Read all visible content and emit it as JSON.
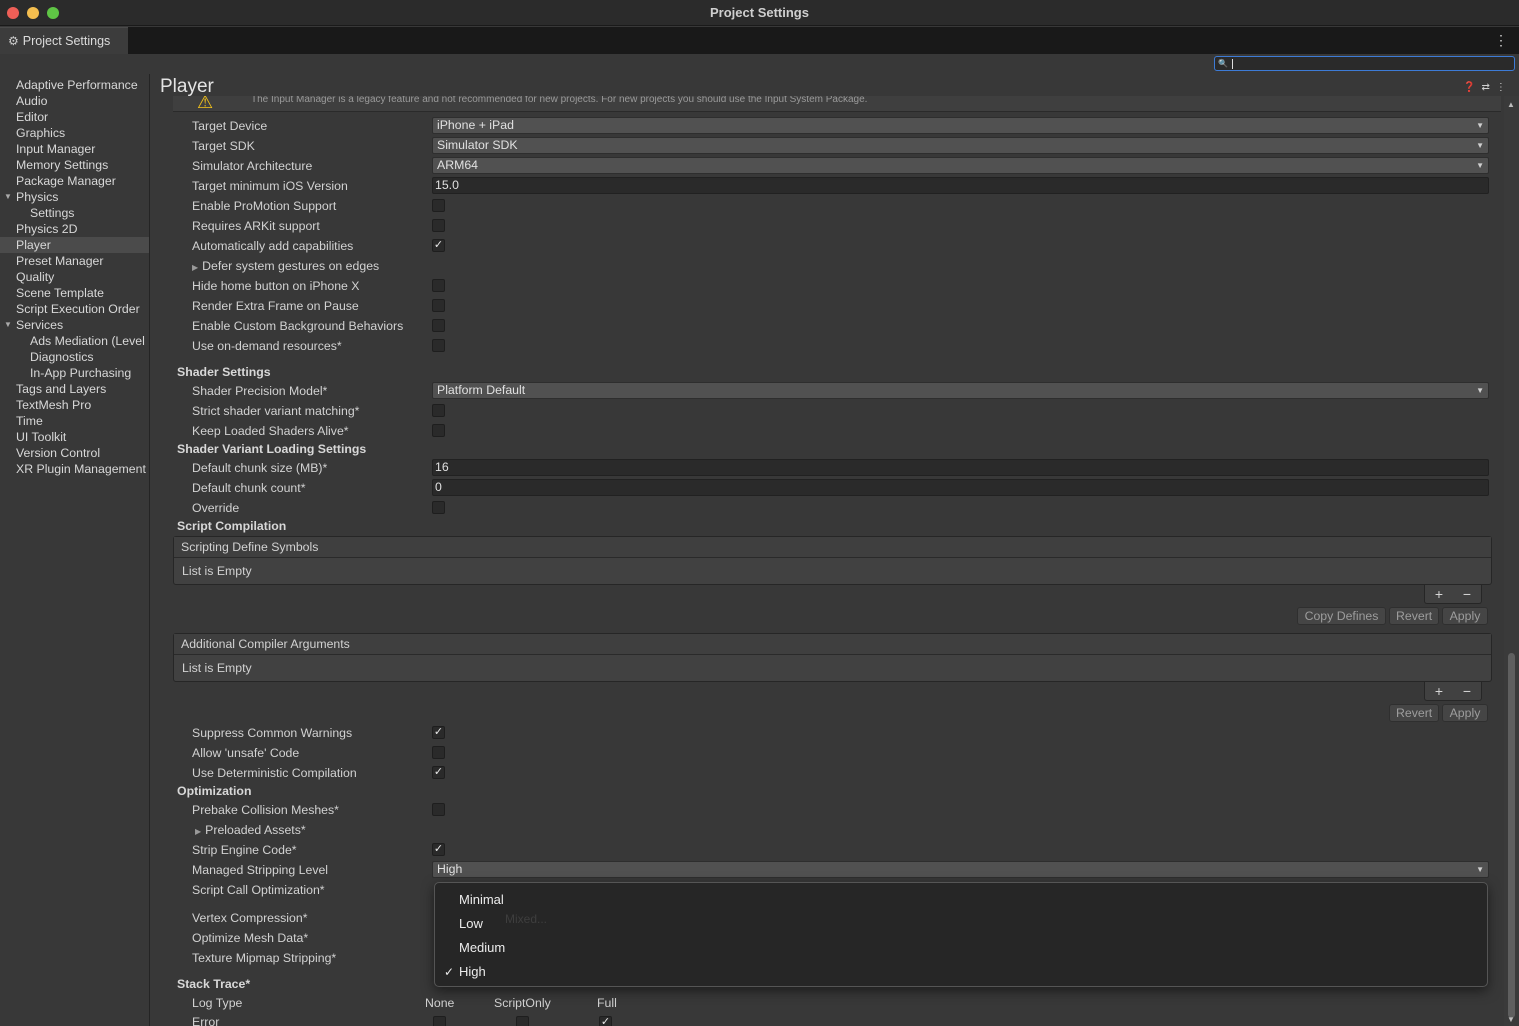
{
  "window": {
    "title": "Project Settings"
  },
  "tab": {
    "label": "Project Settings",
    "icon": "gear-icon"
  },
  "search": {
    "value": ""
  },
  "sidebar": {
    "items": [
      {
        "label": "Adaptive Performance"
      },
      {
        "label": "Audio"
      },
      {
        "label": "Editor"
      },
      {
        "label": "Graphics"
      },
      {
        "label": "Input Manager"
      },
      {
        "label": "Memory Settings"
      },
      {
        "label": "Package Manager"
      },
      {
        "label": "Physics",
        "expanded": true
      },
      {
        "label": "Settings"
      },
      {
        "label": "Physics 2D"
      },
      {
        "label": "Player",
        "selected": true
      },
      {
        "label": "Preset Manager"
      },
      {
        "label": "Quality"
      },
      {
        "label": "Scene Template"
      },
      {
        "label": "Script Execution Order"
      },
      {
        "label": "Services",
        "expanded": true
      },
      {
        "label": "Ads Mediation (Level"
      },
      {
        "label": "Diagnostics"
      },
      {
        "label": "In-App Purchasing"
      },
      {
        "label": "Tags and Layers"
      },
      {
        "label": "TextMesh Pro"
      },
      {
        "label": "Time"
      },
      {
        "label": "UI Toolkit"
      },
      {
        "label": "Version Control"
      },
      {
        "label": "XR Plugin Management"
      }
    ]
  },
  "header": {
    "title": "Player"
  },
  "warning": {
    "text": "The Input Manager is a legacy feature and not recommended for new projects. For new projects you should use the Input System Package."
  },
  "ios": {
    "target_device": {
      "label": "Target Device",
      "value": "iPhone + iPad"
    },
    "target_sdk": {
      "label": "Target SDK",
      "value": "Simulator SDK"
    },
    "sim_arch": {
      "label": "Simulator Architecture",
      "value": "ARM64"
    },
    "min_ios": {
      "label": "Target minimum iOS Version",
      "value": "15.0"
    },
    "promotion": {
      "label": "Enable ProMotion Support",
      "checked": false
    },
    "arkit": {
      "label": "Requires ARKit support",
      "checked": false
    },
    "capabilities": {
      "label": "Automatically add capabilities",
      "checked": true
    },
    "defer_gestures": {
      "label": "Defer system gestures on edges"
    },
    "hide_home": {
      "label": "Hide home button on iPhone X",
      "checked": false
    },
    "extra_frame": {
      "label": "Render Extra Frame on Pause",
      "checked": false
    },
    "custom_bg": {
      "label": "Enable Custom Background Behaviors",
      "checked": false
    },
    "on_demand": {
      "label": "Use on-demand resources*",
      "checked": false
    }
  },
  "shader": {
    "title": "Shader Settings",
    "precision": {
      "label": "Shader Precision Model*",
      "value": "Platform Default"
    },
    "strict": {
      "label": "Strict shader variant matching*",
      "checked": false
    },
    "keep_loaded": {
      "label": "Keep Loaded Shaders Alive*",
      "checked": false
    }
  },
  "variant_loading": {
    "title": "Shader Variant Loading Settings",
    "chunk_size": {
      "label": "Default chunk size (MB)*",
      "value": "16"
    },
    "chunk_count": {
      "label": "Default chunk count*",
      "value": "0"
    },
    "override": {
      "label": "Override",
      "checked": false
    }
  },
  "script_compilation": {
    "title": "Script Compilation",
    "define_symbols": {
      "header": "Scripting Define Symbols",
      "empty": "List is Empty"
    },
    "buttons1": {
      "copy": "Copy Defines",
      "revert": "Revert",
      "apply": "Apply"
    },
    "compiler_args": {
      "header": "Additional Compiler Arguments",
      "empty": "List is Empty"
    },
    "buttons2": {
      "revert": "Revert",
      "apply": "Apply"
    },
    "suppress": {
      "label": "Suppress Common Warnings",
      "checked": true
    },
    "unsafe": {
      "label": "Allow 'unsafe' Code",
      "checked": false
    },
    "deterministic": {
      "label": "Use Deterministic Compilation",
      "checked": true
    }
  },
  "optimization": {
    "title": "Optimization",
    "prebake": {
      "label": "Prebake Collision Meshes*",
      "checked": false
    },
    "preloaded": {
      "label": "Preloaded Assets*"
    },
    "strip": {
      "label": "Strip Engine Code*",
      "checked": true
    },
    "stripping_level": {
      "label": "Managed Stripping Level",
      "value": "High"
    },
    "script_call": {
      "label": "Script Call Optimization*"
    },
    "vertex": {
      "label": "Vertex Compression*"
    },
    "optimize_mesh": {
      "label": "Optimize Mesh Data*"
    },
    "texture_mip": {
      "label": "Texture Mipmap Stripping*"
    }
  },
  "stack_trace": {
    "title": "Stack Trace*",
    "log_type": "Log Type",
    "columns": [
      "None",
      "ScriptOnly",
      "Full"
    ],
    "error": "Error"
  },
  "popup": {
    "ghost": "Mixed...",
    "options": [
      "Minimal",
      "Low",
      "Medium",
      "High"
    ],
    "selected": "High"
  },
  "symbols": {
    "check": "✓",
    "plus": "+",
    "minus": "−"
  }
}
